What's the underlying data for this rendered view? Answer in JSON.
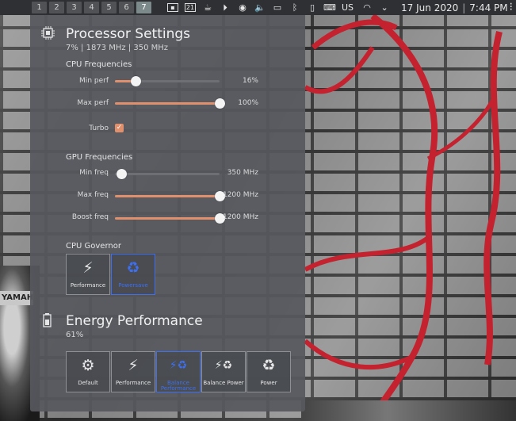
{
  "panel": {
    "desktops": [
      "1",
      "2",
      "3",
      "4",
      "5",
      "6",
      "7"
    ],
    "active_desktop": "7",
    "calendar_day": "21",
    "keyboard_layout": "US",
    "date": "17 Jun 2020",
    "time": "7:44 PM"
  },
  "processor": {
    "title": "Processor Settings",
    "summary": "7% | 1873 MHz | 350 MHz",
    "cpu_heading": "CPU Frequencies",
    "min_perf_label": "Min perf",
    "min_perf_value": "16%",
    "min_perf_level": 0.2,
    "max_perf_label": "Max perf",
    "max_perf_value": "100%",
    "max_perf_level": 1.0,
    "turbo_label": "Turbo",
    "turbo_checked": true,
    "gpu_heading": "GPU Frequencies",
    "min_freq_label": "Min freq",
    "min_freq_value": "350 MHz",
    "min_freq_level": 0.06,
    "max_freq_label": "Max freq",
    "max_freq_value": "1200 MHz",
    "max_freq_level": 1.0,
    "boost_freq_label": "Boost freq",
    "boost_freq_value": "1200 MHz",
    "boost_freq_level": 1.0,
    "governor_heading": "CPU Governor",
    "governors": [
      {
        "label": "Performance",
        "icon": "lightning-icon",
        "selected": false
      },
      {
        "label": "Powersave",
        "icon": "recycle-icon",
        "selected": true
      }
    ]
  },
  "energy": {
    "title": "Energy Performance",
    "value": "61%",
    "modes": [
      {
        "label": "Default",
        "icon": "gear-icon",
        "selected": false
      },
      {
        "label": "Performance",
        "icon": "lightning-icon",
        "selected": false
      },
      {
        "label": "Balance Performance",
        "icon": "lightning-recycle-icon",
        "selected": true
      },
      {
        "label": "Balance Power",
        "icon": "lightning-recycle-icon",
        "selected": false
      },
      {
        "label": "Power",
        "icon": "recycle-icon",
        "selected": false
      }
    ]
  },
  "colors": {
    "accent": "#e0906c",
    "selection": "#3d6ff0",
    "popup_bg": "#56585e",
    "panel_bg": "#2f3033"
  }
}
